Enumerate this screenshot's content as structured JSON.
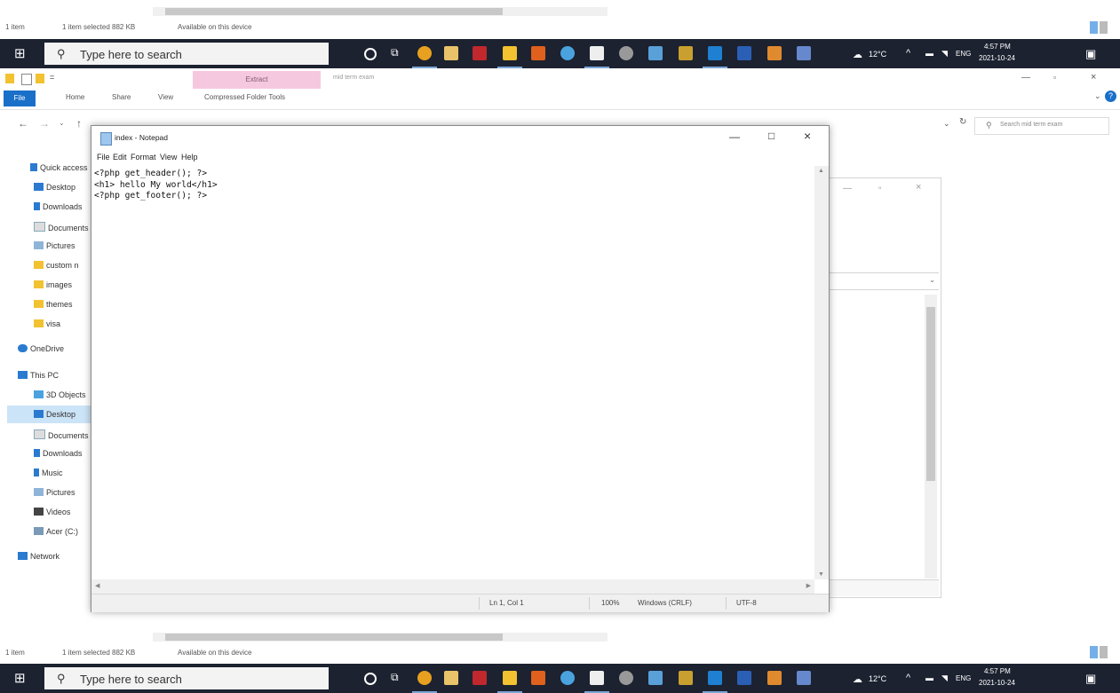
{
  "explorer_status": {
    "item_count": "1 item",
    "selected": "1 item selected  882 KB",
    "availability": "Available on this device"
  },
  "taskbar": {
    "search_placeholder": "Type here to search",
    "weather": "12°C",
    "language": "ENG",
    "time": "4:57 PM",
    "date": "2021-10-24"
  },
  "explorer": {
    "context_tab": "Extract",
    "title": "mid term exam",
    "tabs": [
      "File",
      "Home",
      "Share",
      "View",
      "Compressed Folder Tools"
    ],
    "search_placeholder": "Search mid term exam",
    "nav": {
      "quick_access": "Quick access",
      "desktop": "Desktop",
      "downloads": "Downloads",
      "documents": "Documents",
      "pictures": "Pictures",
      "custom": "custom n",
      "images": "images",
      "themes": "themes",
      "visa": "visa",
      "onedrive": "OneDrive",
      "this_pc": "This PC",
      "objects3d": "3D Objects",
      "pc_desktop": "Desktop",
      "pc_documents": "Documents",
      "pc_downloads": "Downloads",
      "music": "Music",
      "pc_pictures": "Pictures",
      "videos": "Videos",
      "drive_c": "Acer (C:)",
      "network": "Network"
    }
  },
  "notepad": {
    "title": "index - Notepad",
    "menu": [
      "File",
      "Edit",
      "Format",
      "View",
      "Help"
    ],
    "content": "<?php get_header(); ?>\n<h1> hello My world</h1>\n<?php get_footer(); ?>",
    "status": {
      "position": "Ln 1, Col 1",
      "zoom": "100%",
      "line_ending": "Windows (CRLF)",
      "encoding": "UTF-8"
    }
  }
}
